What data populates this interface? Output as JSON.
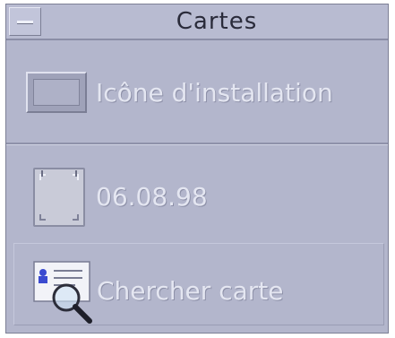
{
  "window": {
    "title": "Cartes"
  },
  "items": [
    {
      "label": "Icône d'installation",
      "icon": "install-icon"
    },
    {
      "label": "06.08.98",
      "icon": "card-icon"
    },
    {
      "label": "Chercher carte",
      "icon": "search-card-icon"
    }
  ],
  "colors": {
    "background": "#b3b6cc",
    "label": "#e4e6f1",
    "title": "#2a2b3a"
  }
}
